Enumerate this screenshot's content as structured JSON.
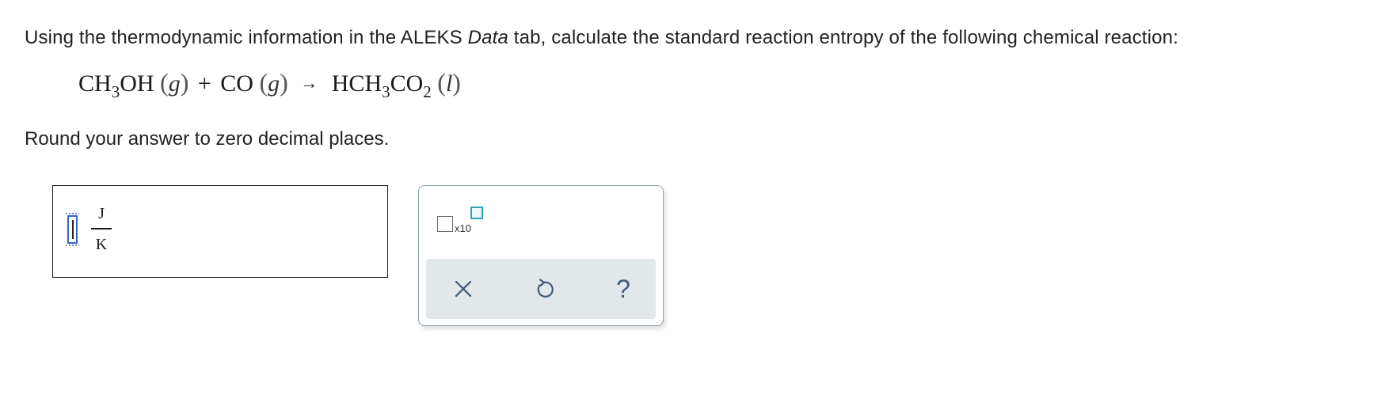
{
  "question": {
    "text_before": "Using the thermodynamic information in the ALEKS ",
    "text_italic": "Data",
    "text_after": " tab, calculate the standard reaction entropy of the following chemical reaction:",
    "instruction": "Round your answer to zero decimal places."
  },
  "equation": {
    "r1_a": "CH",
    "r1_sub": "3",
    "r1_b": "OH",
    "r1_state": "g",
    "plus": "+",
    "r2": "CO",
    "r2_state": "g",
    "arrow": "→",
    "p1_a": "HCH",
    "p1_sub1": "3",
    "p1_b": "CO",
    "p1_sub2": "2",
    "p1_state": "l"
  },
  "answer": {
    "value": "",
    "unit_numerator": "J",
    "unit_denominator": "K"
  },
  "tools": {
    "sci_notation_label": "x10",
    "clear_symbol": "×",
    "undo_symbol": "↺",
    "help_symbol": "?"
  },
  "colors": {
    "slot_border": "#3a63c8",
    "exponent_border": "#2aa3b5",
    "action_bar_bg": "#e2e7ea",
    "icon_color": "#3f5a78"
  }
}
